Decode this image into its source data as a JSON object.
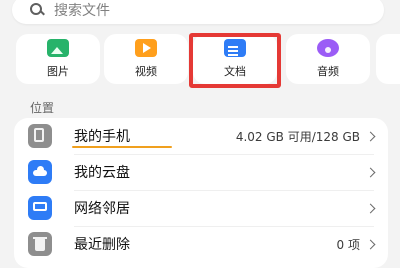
{
  "search": {
    "placeholder": "搜索文件"
  },
  "categories": [
    {
      "label": "图片",
      "icon": "image-icon"
    },
    {
      "label": "视频",
      "icon": "video-icon"
    },
    {
      "label": "文档",
      "icon": "document-icon"
    },
    {
      "label": "音频",
      "icon": "audio-icon"
    }
  ],
  "location": {
    "title": "位置",
    "items": [
      {
        "label": "我的手机",
        "detail": "4.02 GB 可用/128 GB",
        "icon": "phone-icon"
      },
      {
        "label": "我的云盘",
        "detail": "",
        "icon": "cloud-icon"
      },
      {
        "label": "网络邻居",
        "detail": "",
        "icon": "network-icon"
      },
      {
        "label": "最近删除",
        "detail": "0 项",
        "icon": "trash-icon"
      }
    ]
  },
  "colors": {
    "highlight": "#e53935",
    "accent_blue": "#2e7cf6",
    "underline": "#f0a01e"
  }
}
